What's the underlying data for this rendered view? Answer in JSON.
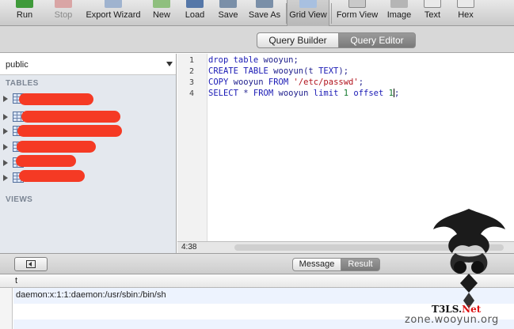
{
  "toolbar": {
    "buttons": [
      {
        "label": "Run",
        "icon": "run-icon"
      },
      {
        "label": "Stop",
        "icon": "stop-icon"
      },
      {
        "label": "Export Wizard",
        "icon": "export-wizard-icon"
      },
      {
        "label": "New",
        "icon": "new-table-icon"
      },
      {
        "label": "Load",
        "icon": "load-icon"
      },
      {
        "label": "Save",
        "icon": "save-icon"
      },
      {
        "label": "Save As",
        "icon": "save-as-icon"
      },
      {
        "label": "Grid View",
        "icon": "grid-view-icon"
      },
      {
        "label": "Form View",
        "icon": "form-view-icon"
      },
      {
        "label": "Image",
        "icon": "image-icon"
      },
      {
        "label": "Text",
        "icon": "text-icon"
      },
      {
        "label": "Hex",
        "icon": "hex-icon"
      }
    ]
  },
  "modes": {
    "builder": "Query Builder",
    "editor": "Query Editor",
    "active": "Query Editor"
  },
  "sidebar": {
    "schema": "public",
    "tables_heading": "TABLES",
    "views_heading": "VIEWS"
  },
  "editor": {
    "lines": [
      {
        "n": "1"
      },
      {
        "n": "2"
      },
      {
        "n": "3"
      },
      {
        "n": "4"
      }
    ],
    "code": {
      "l1a": "drop table",
      "l1b": " wooyun;",
      "l2a": "CREATE TABLE",
      "l2b": " wooyun(t ",
      "l2c": "TEXT",
      "l2d": ");",
      "l3a": "COPY",
      "l3b": " wooyun ",
      "l3c": "FROM",
      "l3d": " ",
      "l3e": "'/etc/passwd'",
      "l3f": ";",
      "l4a": "SELECT",
      "l4b": " * ",
      "l4c": "FROM",
      "l4d": " wooyun ",
      "l4e": "limit",
      "l4f": " ",
      "l4g": "1",
      "l4h": " ",
      "l4i": "offset",
      "l4j": " ",
      "l4k": "1",
      "l4l": ";"
    },
    "cursor_pos": "4:38"
  },
  "results": {
    "tabs": {
      "message": "Message",
      "result": "Result",
      "active": "Result"
    },
    "column": "t",
    "rows": [
      "daemon:x:1:1:daemon:/usr/sbin:/bin/sh"
    ]
  },
  "watermark": {
    "brand_a": "T",
    "brand_b": "3",
    "brand_c": "L",
    "brand_d": "S",
    "brand_e": ".",
    "brand_net": "Net",
    "site": "zone.wooyun.org"
  },
  "colors": {
    "redaction": "#f53a24",
    "active_segment": "#8a8a8a",
    "sidebar_bg": "#e4e8ee"
  }
}
